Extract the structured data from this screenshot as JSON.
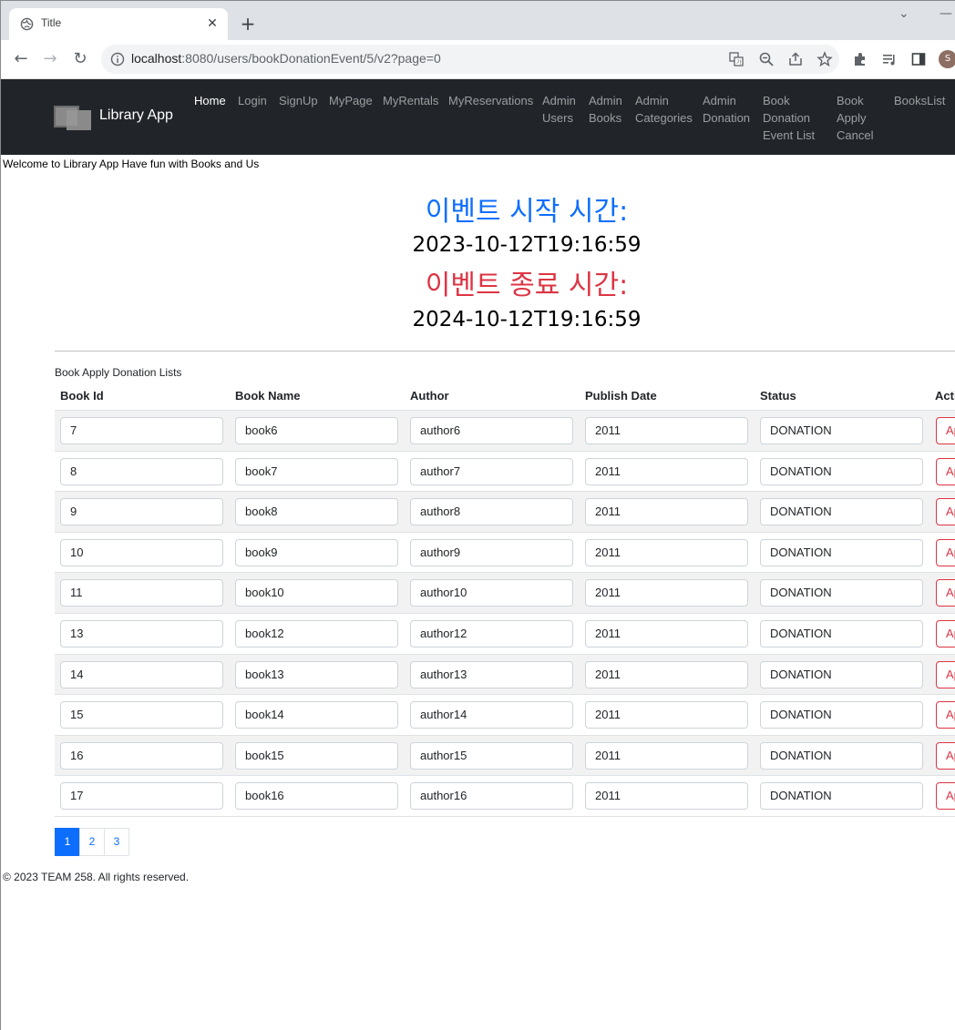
{
  "browser": {
    "tab_title": "Title",
    "url_host": "localhost",
    "url_rest": ":8080/users/bookDonationEvent/5/v2?page=0",
    "profile_initial": "S"
  },
  "navbar": {
    "brand": "Library App",
    "links": [
      {
        "label": "Home",
        "active": true
      },
      {
        "label": "Login"
      },
      {
        "label": "SignUp"
      },
      {
        "label": "MyPage"
      },
      {
        "label": "MyRentals"
      },
      {
        "label": "MyReservations"
      },
      {
        "label": "Admin\nUsers"
      },
      {
        "label": "Admin\nBooks"
      },
      {
        "label": "Admin\nCategories"
      },
      {
        "label": "Admin\nDonation"
      },
      {
        "label": "Book\nDonation\nEvent List"
      },
      {
        "label": "Book\nApply\nCancel"
      },
      {
        "label": "BooksList"
      }
    ]
  },
  "welcome": "Welcome to Library App Have fun with Books and Us",
  "event": {
    "start_label": "이벤트 시작 시간:",
    "start_time": "2023-10-12T19:16:59",
    "end_label": "이벤트 종료 시간:",
    "end_time": "2024-10-12T19:16:59"
  },
  "table": {
    "caption": "Book Apply Donation Lists",
    "headers": [
      "Book Id",
      "Book Name",
      "Author",
      "Publish Date",
      "Status",
      "Acti"
    ],
    "action_label": "Ap",
    "rows": [
      {
        "id": "7",
        "name": "book6",
        "author": "author6",
        "date": "2011",
        "status": "DONATION"
      },
      {
        "id": "8",
        "name": "book7",
        "author": "author7",
        "date": "2011",
        "status": "DONATION"
      },
      {
        "id": "9",
        "name": "book8",
        "author": "author8",
        "date": "2011",
        "status": "DONATION"
      },
      {
        "id": "10",
        "name": "book9",
        "author": "author9",
        "date": "2011",
        "status": "DONATION"
      },
      {
        "id": "11",
        "name": "book10",
        "author": "author10",
        "date": "2011",
        "status": "DONATION"
      },
      {
        "id": "13",
        "name": "book12",
        "author": "author12",
        "date": "2011",
        "status": "DONATION"
      },
      {
        "id": "14",
        "name": "book13",
        "author": "author13",
        "date": "2011",
        "status": "DONATION"
      },
      {
        "id": "15",
        "name": "book14",
        "author": "author14",
        "date": "2011",
        "status": "DONATION"
      },
      {
        "id": "16",
        "name": "book15",
        "author": "author15",
        "date": "2011",
        "status": "DONATION"
      },
      {
        "id": "17",
        "name": "book16",
        "author": "author16",
        "date": "2011",
        "status": "DONATION"
      }
    ]
  },
  "pagination": {
    "pages": [
      "1",
      "2",
      "3"
    ],
    "current": "1"
  },
  "footer": "© 2023 TEAM 258. All rights reserved.",
  "colors": {
    "start": "#0d6efd",
    "end": "#dc3545",
    "navbar": "#212529",
    "danger": "#dc3545"
  }
}
